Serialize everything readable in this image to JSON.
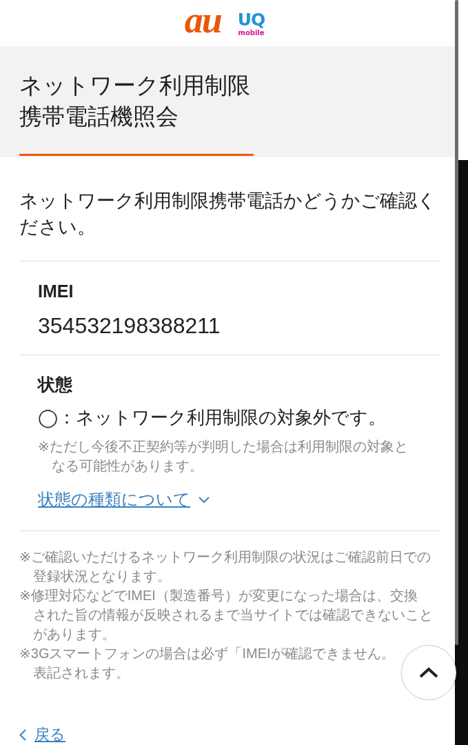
{
  "header": {
    "logos": [
      {
        "kind": "au",
        "text": "au"
      },
      {
        "kind": "uq",
        "text": "UQ",
        "caption": "mobile"
      }
    ]
  },
  "title": {
    "lines": [
      "ネットワーク利用制限",
      "携帯電話機照会"
    ]
  },
  "intro": {
    "lines": [
      "ネットワーク利用制限携帯電話かどうかご確認く",
      "ださい。"
    ]
  },
  "imei": {
    "label": "IMEI",
    "value": "354532198388211"
  },
  "state": {
    "label": "状態",
    "status": "◯：ネットワーク利用制限の対象外です。",
    "note_lines": [
      "※ただし今後不正契約等が判明した場合は利用制限の対象と",
      "なる可能性があります。"
    ],
    "link": {
      "label": "状態の種類について",
      "expanded": false
    }
  },
  "footnotes": [
    {
      "lines": [
        "※ご確認いただけるネットワーク利用制限の状況はご確認前日での",
        "登録状況となります。"
      ]
    },
    {
      "lines": [
        "※修理対応などでIMEI（製造番号）が変更になった場合は、交換",
        "された旨の情報が反映されるまで当サイトでは確認できないこと",
        "があります。"
      ]
    },
    {
      "lines": [
        "※3Gスマートフォンの場合は必ず「IMEIが確認できません。",
        "表記されます。"
      ]
    }
  ],
  "back_link": {
    "label": "戻る"
  }
}
